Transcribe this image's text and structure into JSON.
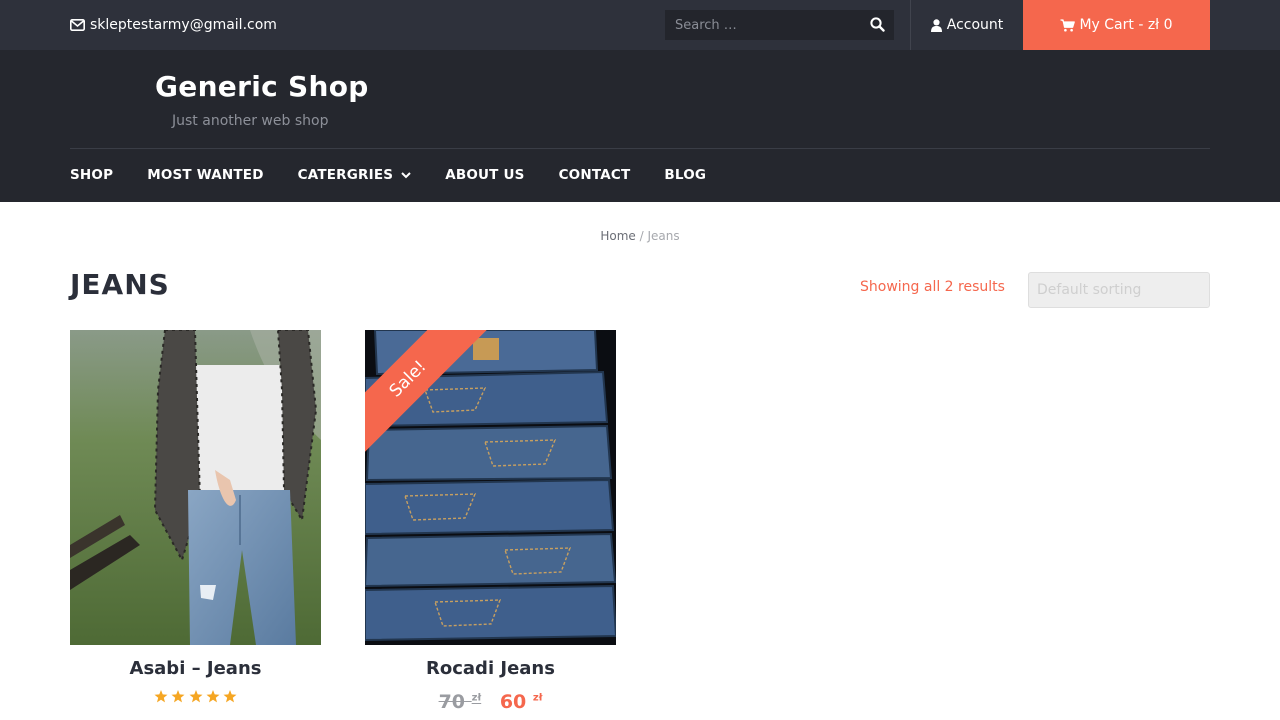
{
  "topbar": {
    "email": "skleptestarmy@gmail.com",
    "search_placeholder": "Search …",
    "account_label": "Account",
    "cart_label": "My Cart - zł 0",
    "icons": {
      "email": "envelope-icon",
      "search": "search-icon",
      "account": "user-icon",
      "cart": "cart-icon"
    }
  },
  "header": {
    "site_title": "Generic Shop",
    "tagline": "Just another web shop"
  },
  "nav": {
    "items": [
      {
        "label": "SHOP"
      },
      {
        "label": "MOST WANTED"
      },
      {
        "label": "CATERGRIES",
        "has_dropdown": true
      },
      {
        "label": "ABOUT US"
      },
      {
        "label": "CONTACT"
      },
      {
        "label": "BLOG"
      }
    ]
  },
  "breadcrumb": {
    "home": "Home",
    "separator": " / ",
    "current": "Jeans"
  },
  "page": {
    "title": "JEANS",
    "result_count": "Showing all 2 results",
    "sort_selected": "Default sorting"
  },
  "products": [
    {
      "name": "Asabi – Jeans",
      "rating_stars": 5
    },
    {
      "name": "Rocadi Jeans",
      "badge": "Sale!",
      "old_price": "70",
      "new_price": "60",
      "currency": "zł"
    }
  ],
  "colors": {
    "accent": "#f5674d",
    "topbar_bg": "#2e313b",
    "header_bg": "#25272e",
    "star": "#f5a623"
  }
}
